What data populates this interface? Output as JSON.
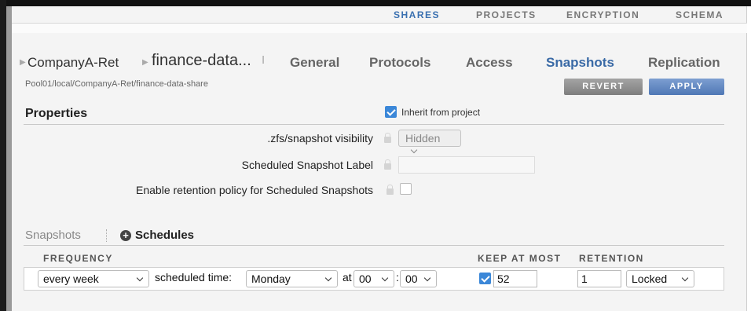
{
  "top_nav": [
    {
      "label": "SHARES"
    },
    {
      "label": "PROJECTS"
    },
    {
      "label": "ENCRYPTION"
    },
    {
      "label": "SCHEMA"
    }
  ],
  "breadcrumb": {
    "project": "CompanyA-Ret",
    "share": "finance-data..."
  },
  "tabs": [
    {
      "label": "General"
    },
    {
      "label": "Protocols"
    },
    {
      "label": "Access"
    },
    {
      "label": "Snapshots"
    },
    {
      "label": "Replication"
    }
  ],
  "path": "Pool01/local/CompanyA-Ret/finance-data-share",
  "actions": {
    "revert": "REVERT",
    "apply": "APPLY"
  },
  "properties": {
    "title": "Properties",
    "inherit_label": "Inherit from project",
    "inherit_checked": true,
    "visibility_label": ".zfs/snapshot visibility",
    "visibility_value": "Hidden",
    "sched_label_label": "Scheduled Snapshot Label",
    "sched_label_value": "",
    "retention_label": "Enable retention policy for Scheduled Snapshots",
    "retention_checked": false
  },
  "subtabs": {
    "snapshots": "Snapshots",
    "schedules": "Schedules"
  },
  "schedule": {
    "headers": {
      "frequency": "FREQUENCY",
      "keep": "KEEP AT MOST",
      "retention": "RETENTION"
    },
    "frequency": "every week",
    "scheduled_time_label": "scheduled time:",
    "day": "Monday",
    "at_label": "at",
    "hour": "00",
    "colon": ":",
    "minute": "00",
    "keep_checked": true,
    "keep_value": "52",
    "retention_value": "1",
    "retention_mode": "Locked"
  }
}
